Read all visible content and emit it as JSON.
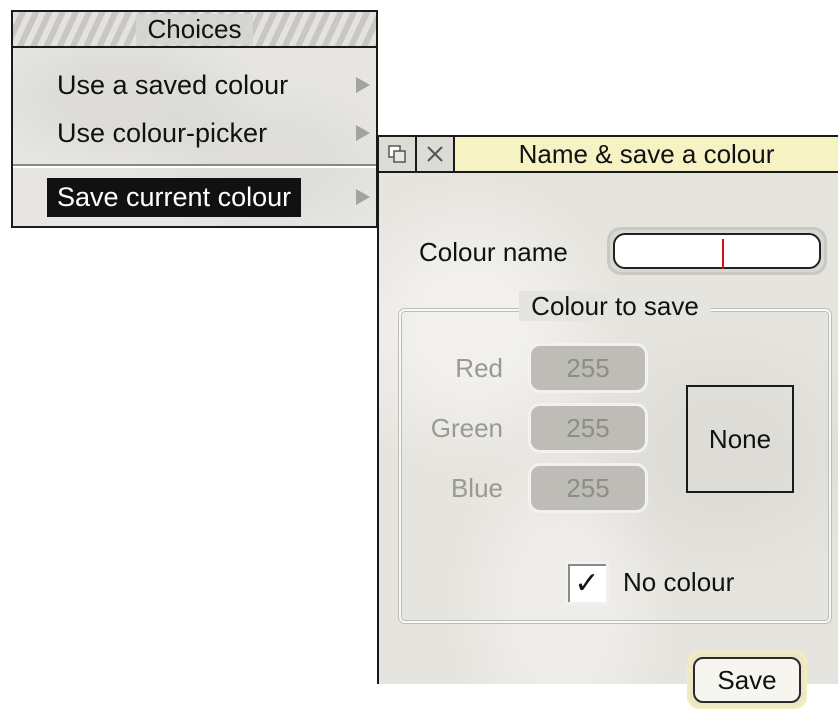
{
  "menu": {
    "title": "Choices",
    "items": [
      {
        "label": "Use a saved colour"
      },
      {
        "label": "Use colour-picker"
      },
      {
        "label": "Save current colour"
      }
    ]
  },
  "dialog": {
    "title": "Name & save a colour",
    "colour_name": {
      "label": "Colour name",
      "value": ""
    },
    "group_title": "Colour to save",
    "red": {
      "label": "Red",
      "value": "255"
    },
    "green": {
      "label": "Green",
      "value": "255"
    },
    "blue": {
      "label": "Blue",
      "value": "255"
    },
    "preview_text": "None",
    "no_colour": {
      "label": "No colour",
      "checked": true,
      "mark": "✓"
    },
    "save_label": "Save"
  }
}
